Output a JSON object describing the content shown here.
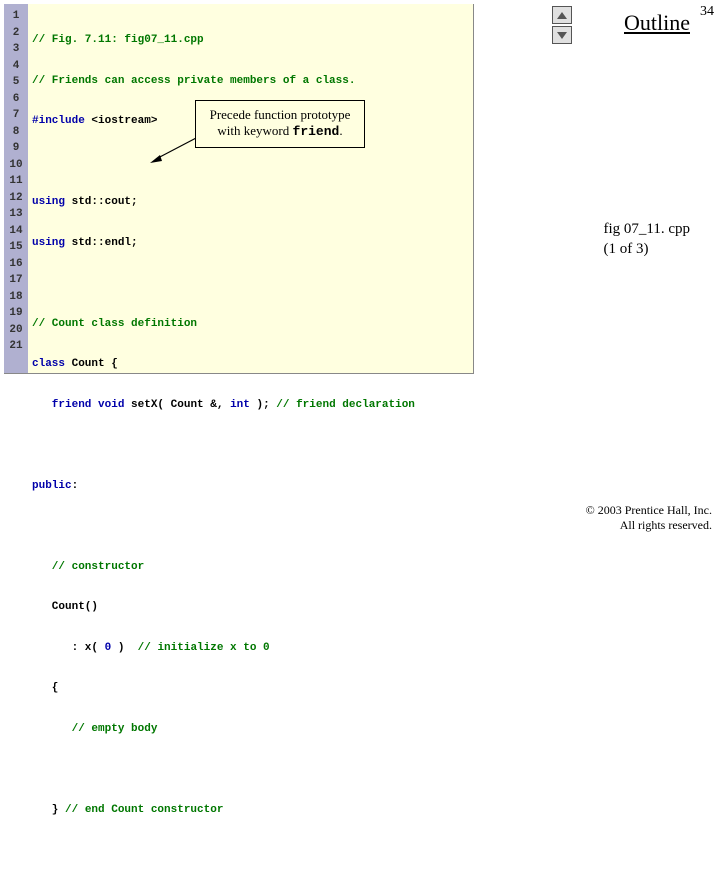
{
  "page_number": "34",
  "outline_label": "Outline",
  "fig_label_line1": "fig 07_11. cpp",
  "fig_label_line2": "(1 of 3)",
  "copyright_line1": "© 2003 Prentice Hall, Inc.",
  "copyright_line2": "All rights reserved.",
  "callout_line1": "Precede function prototype",
  "callout_line2_a": "with keyword ",
  "callout_line2_b": "friend",
  "callout_line2_c": ".",
  "gutter": [
    "1",
    "2",
    "3",
    "4",
    "5",
    "6",
    "7",
    "8",
    "9",
    "10",
    "11",
    "12",
    "13",
    "14",
    "15",
    "16",
    "17",
    "18",
    "19",
    "20",
    "21"
  ],
  "code": {
    "l1_cm": "// Fig. 7.11: fig07_11.cpp",
    "l2_cm": "// Friends can access private members of a class.",
    "l3_a": "#include ",
    "l3_b": "<iostream>",
    "l5_a": "using ",
    "l5_b": "std::cout;",
    "l6_a": "using ",
    "l6_b": "std::endl;",
    "l8_cm": "// Count class definition",
    "l9_a": "class ",
    "l9_b": "Count {",
    "l10_a": "   friend void ",
    "l10_b": "setX( Count &, ",
    "l10_c": "int",
    "l10_d": " ); ",
    "l10_cm": "// friend declaration",
    "l12_a": "public",
    "l12_b": ":",
    "l14_cm": "   // constructor",
    "l15": "   Count()",
    "l16_a": "      : x( ",
    "l16_b": "0",
    "l16_c": " )  ",
    "l16_cm": "// initialize x to 0",
    "l17": "   {",
    "l18_cm": "      // empty body",
    "l20_a": "   } ",
    "l20_cm": "// end Count constructor"
  }
}
